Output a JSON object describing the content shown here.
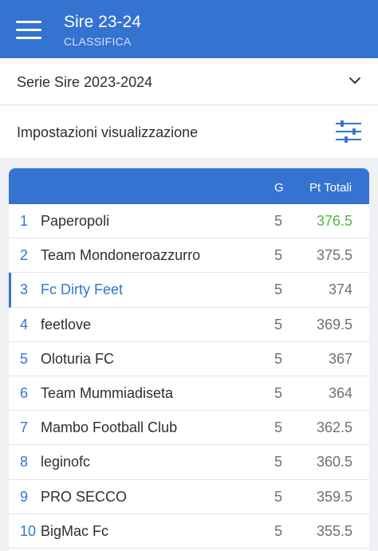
{
  "appbar": {
    "title": "Sire 23-24",
    "subtitle": "CLASSIFICA"
  },
  "league_select": {
    "label": "Serie Sire 2023-2024",
    "icon": "chevron-down-icon"
  },
  "settings": {
    "label": "Impostazioni visualizzazione",
    "icon": "sliders-icon"
  },
  "table": {
    "headers": {
      "games": "G",
      "points": "Pt Totali"
    },
    "rows": [
      {
        "rank": "1",
        "team": "Paperopoli",
        "g": "5",
        "pts": "376.5"
      },
      {
        "rank": "2",
        "team": "Team Mondoneroazzurro",
        "g": "5",
        "pts": "375.5"
      },
      {
        "rank": "3",
        "team": "Fc Dirty Feet",
        "g": "5",
        "pts": "374"
      },
      {
        "rank": "4",
        "team": "feetlove",
        "g": "5",
        "pts": "369.5"
      },
      {
        "rank": "5",
        "team": "Oloturia FC",
        "g": "5",
        "pts": "367"
      },
      {
        "rank": "6",
        "team": "Team Mummiadiseta",
        "g": "5",
        "pts": "364"
      },
      {
        "rank": "7",
        "team": "Mambo Football Club",
        "g": "5",
        "pts": "362.5"
      },
      {
        "rank": "8",
        "team": "leginofc",
        "g": "5",
        "pts": "360.5"
      },
      {
        "rank": "9",
        "team": "PRO SECCO",
        "g": "5",
        "pts": "359.5"
      },
      {
        "rank": "10",
        "team": "BigMac Fc",
        "g": "5",
        "pts": "355.5"
      }
    ]
  },
  "colors": {
    "primary": "#3573d1",
    "leader_points": "#58b546",
    "background": "#eef0f3"
  }
}
